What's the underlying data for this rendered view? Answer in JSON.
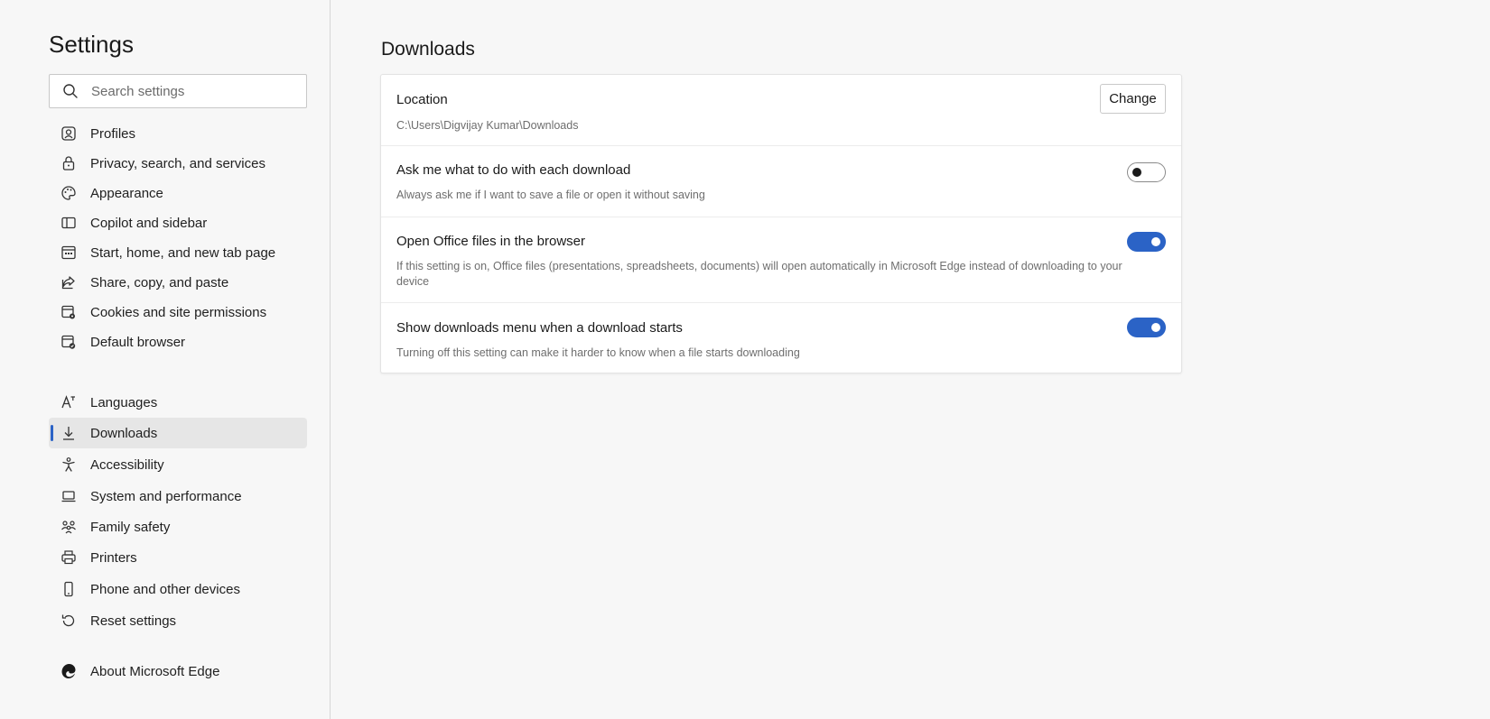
{
  "sidebar": {
    "title": "Settings",
    "search_placeholder": "Search settings",
    "items": [
      {
        "label": "Profiles",
        "icon": "profile-icon"
      },
      {
        "label": "Privacy, search, and services",
        "icon": "lock-icon"
      },
      {
        "label": "Appearance",
        "icon": "palette-icon"
      },
      {
        "label": "Copilot and sidebar",
        "icon": "sidebar-icon"
      },
      {
        "label": "Start, home, and new tab page",
        "icon": "home-page-icon"
      },
      {
        "label": "Share, copy, and paste",
        "icon": "share-icon"
      },
      {
        "label": "Cookies and site permissions",
        "icon": "cookies-icon"
      },
      {
        "label": "Default browser",
        "icon": "default-browser-icon"
      },
      {
        "label": "Languages",
        "icon": "languages-icon"
      },
      {
        "label": "Downloads",
        "icon": "download-icon",
        "active": true
      },
      {
        "label": "Accessibility",
        "icon": "accessibility-icon"
      },
      {
        "label": "System and performance",
        "icon": "laptop-icon"
      },
      {
        "label": "Family safety",
        "icon": "family-icon"
      },
      {
        "label": "Printers",
        "icon": "printer-icon"
      },
      {
        "label": "Phone and other devices",
        "icon": "phone-icon"
      },
      {
        "label": "Reset settings",
        "icon": "reset-icon"
      },
      {
        "label": "About Microsoft Edge",
        "icon": "edge-logo-icon"
      }
    ]
  },
  "main": {
    "title": "Downloads",
    "location": {
      "title": "Location",
      "path": "C:\\Users\\Digvijay Kumar\\Downloads",
      "button_label": "Change"
    },
    "settings": [
      {
        "title": "Ask me what to do with each download",
        "description": "Always ask me if I want to save a file or open it without saving",
        "enabled": false
      },
      {
        "title": "Open Office files in the browser",
        "description": "If this setting is on, Office files (presentations, spreadsheets, documents) will open automatically in Microsoft Edge instead of downloading to your device",
        "enabled": true
      },
      {
        "title": "Show downloads menu when a download starts",
        "description": "Turning off this setting can make it harder to know when a file starts downloading",
        "enabled": true
      }
    ]
  },
  "colors": {
    "accent": "#2b63c6",
    "background": "#f7f7f7",
    "card": "#ffffff"
  }
}
